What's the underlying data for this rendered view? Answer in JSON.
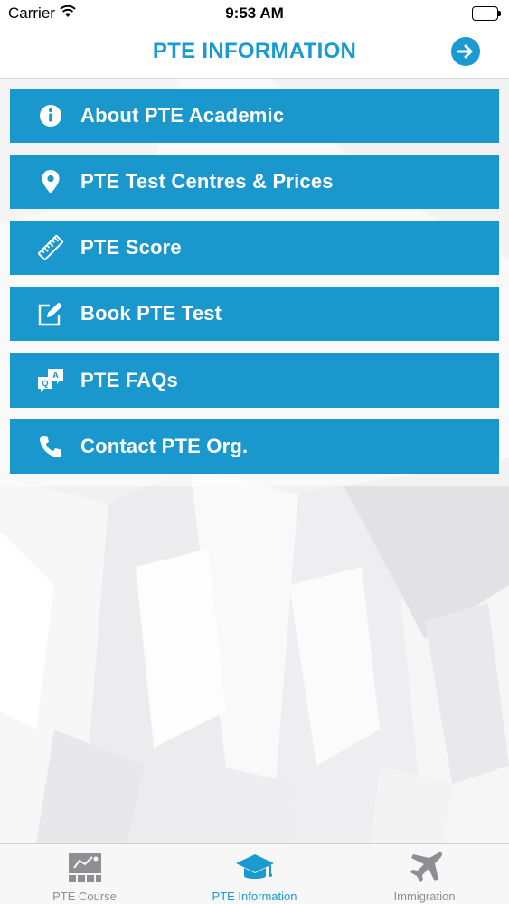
{
  "status_bar": {
    "carrier": "Carrier",
    "time": "9:53 AM"
  },
  "nav": {
    "title": "PTE INFORMATION",
    "next_icon": "arrow-right-circle-icon"
  },
  "menu": {
    "items": [
      {
        "label": "About PTE Academic",
        "icon": "info-icon"
      },
      {
        "label": "PTE Test Centres & Prices",
        "icon": "map-pin-icon"
      },
      {
        "label": "PTE Score",
        "icon": "ruler-icon"
      },
      {
        "label": "Book PTE Test",
        "icon": "edit-icon"
      },
      {
        "label": "PTE FAQs",
        "icon": "qa-chat-icon"
      },
      {
        "label": "Contact PTE Org.",
        "icon": "phone-icon"
      }
    ]
  },
  "tabs": [
    {
      "label": "PTE Course",
      "icon": "course-board-icon",
      "active": false
    },
    {
      "label": "PTE Information",
      "icon": "graduation-cap-icon",
      "active": true
    },
    {
      "label": "Immigration",
      "icon": "airplane-icon",
      "active": false
    }
  ],
  "colors": {
    "accent": "#1a9ad0",
    "menu_background": "#1a97cd",
    "tab_inactive": "#8e8e93"
  }
}
